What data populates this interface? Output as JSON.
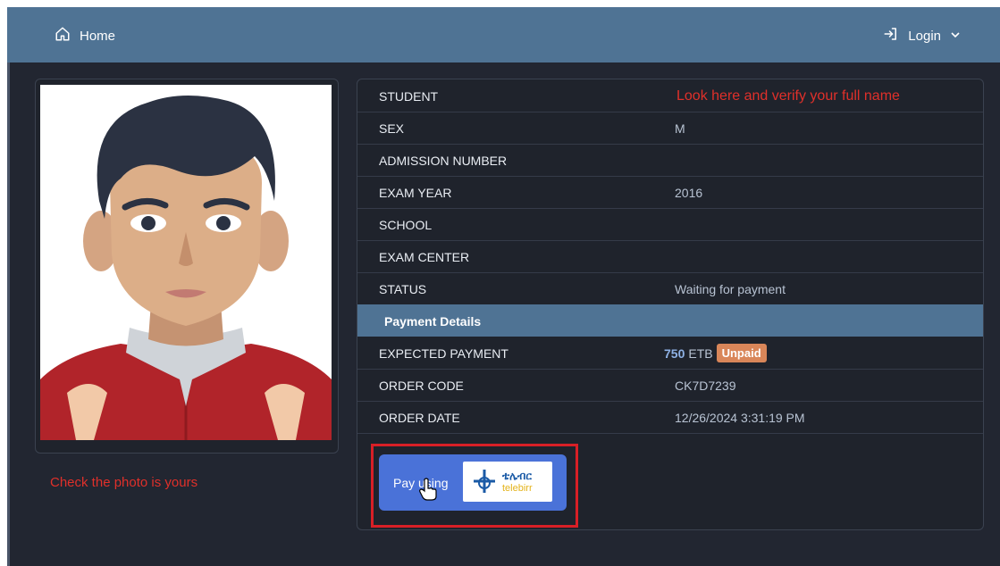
{
  "nav": {
    "home_label": "Home",
    "login_label": "Login"
  },
  "photo": {
    "caption": "Check the photo is yours"
  },
  "student_info": {
    "verify_note": "Look here and verify your full name",
    "rows": [
      {
        "label": "STUDENT",
        "value": ""
      },
      {
        "label": "SEX",
        "value": "M"
      },
      {
        "label": "ADMISSION NUMBER",
        "value": ""
      },
      {
        "label": "EXAM YEAR",
        "value": "2016"
      },
      {
        "label": "SCHOOL",
        "value": ""
      },
      {
        "label": "EXAM CENTER",
        "value": ""
      },
      {
        "label": "STATUS",
        "value": "Waiting for payment"
      }
    ]
  },
  "payment": {
    "section_title": "Payment Details",
    "expected_label": "EXPECTED PAYMENT",
    "amount": "750",
    "currency": "ETB",
    "status_badge": "Unpaid",
    "order_code_label": "ORDER CODE",
    "order_code": "CK7D7239",
    "order_date_label": "ORDER DATE",
    "order_date": "12/26/2024 3:31:19 PM",
    "pay_button_label": "Pay using",
    "provider_amharic": "ቴሌብር",
    "provider_name": "telebirr"
  },
  "colors": {
    "navbar": "#4f7394",
    "background": "#222631",
    "annotation_red": "#e0302a",
    "pay_button": "#4a72d8",
    "badge": "#d98659"
  }
}
